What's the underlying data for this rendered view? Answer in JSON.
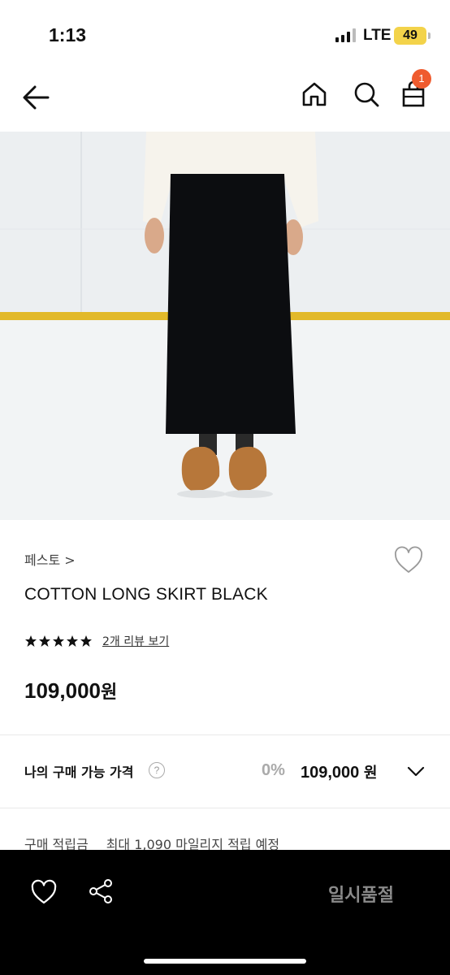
{
  "status_bar": {
    "time": "1:13",
    "network": "LTE",
    "battery": "49"
  },
  "nav": {
    "back_icon": "arrow-left-icon",
    "home_icon": "home-icon",
    "search_icon": "search-icon",
    "cart_icon": "shopping-bag-icon",
    "cart_count": "1"
  },
  "product": {
    "image_alt": "black long skirt",
    "brand": "페스토 >",
    "name": "COTTON LONG SKIRT BLACK",
    "rating": 5,
    "rating_max": 5,
    "review_link": "2개 리뷰 보기",
    "price": "109,000",
    "price_unit": "원"
  },
  "my_price": {
    "label": "나의 구매 가능 가격",
    "help": "?",
    "discount": "0%",
    "price": "109,000",
    "price_unit": "원"
  },
  "points": {
    "label": "구매 적립금",
    "value": "최대 1,090 마일리지 적립 예정"
  },
  "bottom_bar": {
    "soldout_label": "일시품절"
  },
  "colors": {
    "accent_badge": "#ef5b2e",
    "bottom_bar_bg": "#000000",
    "soldout_text": "#8a8a8a"
  }
}
